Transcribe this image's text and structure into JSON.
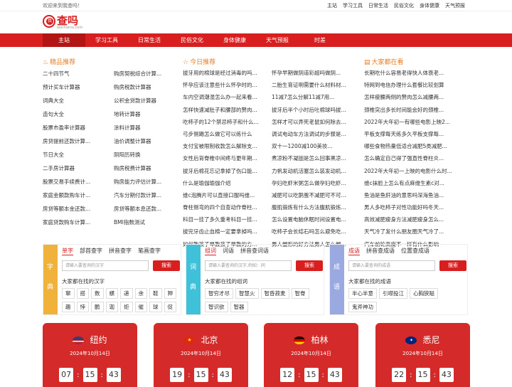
{
  "topbar": {
    "welcome": "欢迎来到我查吗！",
    "links": [
      "主站",
      "学习工具",
      "日常生活",
      "民俗文化",
      "身体健康",
      "天气预报"
    ]
  },
  "logo": {
    "badge": "我",
    "name": "查吗",
    "sub": "wochama.com"
  },
  "nav": [
    "主站",
    "学习工具",
    "日常生活",
    "民俗文化",
    "身体健康",
    "天气预报",
    "时差"
  ],
  "recommend": {
    "title": "精品推荐",
    "items": [
      "二十四节气",
      "购房契税综合计算...",
      "预计买车计算器",
      "购房税款计算器",
      "词典大全",
      "公积金贷款计算器",
      "造句大全",
      "地转计算器",
      "股票市盈率计算器",
      "涂料计算器",
      "房贷提前还款计算...",
      "油价调整计算器",
      "节日大全",
      "阴阳历转换",
      "二手房计算器",
      "购房税费计算器",
      "股票交易手续费计...",
      "购房能力评估计算...",
      "家庭金额款购车计...",
      "汽车分期付款计算...",
      "房贷等额本金还款...",
      "房贷等额本息还款...",
      "家庭贷款购车计算...",
      "BMI指数测试"
    ]
  },
  "today": {
    "title": "今日推荐",
    "items": [
      "拔牙用的棉球是经过消毒的吗...",
      "怀孕早期做阴道彩超吗做阴...",
      "怀孕应该注意些什么怀孕时的...",
      "二胎生育证明需要什么材料材...",
      "车内空调潮湿怎么办一起来看...",
      "11减7怎么分解11减7用...",
      "怎样快速减肚子和腰部的赘肉...",
      "拔牙后半个小时后吐棉球吗拔...",
      "吃柿子的12个禁忌柿子和什么...",
      "怎样才可以弄死老鼠如何除去...",
      "弓步侧踢怎么做它可以练什么",
      "调试电动车方法调试的步骤是...",
      "支付宝被限制收款怎么解除支...",
      "双十一1200减100美妆...",
      "女性后背脊椎中间疼与更年期...",
      "煮凉粉不凝固是怎么回事黑凉...",
      "拔牙后棉花忘记拿掉了伤口能...",
      "力帆发动机活塞怎么装发动机...",
      "什么是瑜伽瑜伽介绍",
      "孕妇吃虾米粥怎么做孕妇吃虾...",
      "维c泡腾片可以直接口服吗维...",
      "减肥可以吃鹅蛋不减肥可不可...",
      "脊柱侧弯的四个自查动作脊柱...",
      "腹肌锻炼有什么方法腹肌锻炼...",
      "科目一挂了多久重考科目一挂...",
      "怎么设置电脑休眠时间设置电...",
      "拔完牙齿止血棉一定要拿掉吗...",
      "吃柿子会长结石吗怎么避免吃...",
      "如何教孩子早教孩子早教的方...",
      "男人塑形的好方法男人怎么塑..."
    ]
  },
  "hot": {
    "title": "大家都在看",
    "items": [
      "长期吃什么容易老得快人体衰老...",
      "特网到电信办理什么套餐比较划算",
      "怎样瘦腰两侧的赘肉怎么减腰两...",
      "颈椎突出多长时间能会好的颈椎...",
      "2022年大年初一有哪些电影上映2...",
      "平板支撑每天练多久平板支撑每...",
      "哪些食物热量低适合减肥5类减肥...",
      "怎么确定自己得了强直性脊柱炎...",
      "2022年大年初一上映的电影什么时...",
      "维c抹脸上怎么有点麻维生素c对...",
      "鱼油是鱼肝油的意思吗深海鱼油...",
      "男人多吃柿子对性功能好吗冬天...",
      "高效减肥瘦身方法减肥瘦身怎么...",
      "天气冷了发什么朋友圈天气冷了...",
      "汽车前轮高度不一样有什么影响"
    ]
  },
  "dicts": [
    {
      "side": [
        "字",
        "典"
      ],
      "tabs": [
        "单字",
        "部首查字",
        "拼音查字",
        "笔画查字"
      ],
      "placeholder": "请输入要查询的汉字",
      "button": "搜索",
      "hint": "大家都在找的汉字",
      "chips": [
        "窜",
        "搭",
        "数",
        "蟥",
        "递",
        "余",
        "鞋",
        "狎",
        "趣",
        "悖",
        "鹏",
        "迦",
        "炬",
        "催",
        "球",
        "促"
      ]
    },
    {
      "side": [
        "词",
        "典"
      ],
      "tabs": [
        "组词",
        "词语",
        "拼音查词语"
      ],
      "placeholder": "请输入要查询的汉字,例如：同",
      "button": "搜索",
      "hint": "大家都在找的组词",
      "chips": [
        "智穷才尽",
        "智慧火",
        "智昏菽麦",
        "智脊",
        "智识欲",
        "智器"
      ]
    },
    {
      "side": [
        "成",
        "语"
      ],
      "tabs": [
        "成语",
        "拼音查成语",
        "位置查成语"
      ],
      "placeholder": "请输入要查询的成语",
      "button": "搜索",
      "hint": "大家都在找的成语",
      "chips": [
        "半心半意",
        "引噤投江",
        "心胸狭隘",
        "鬼斧神功"
      ]
    }
  ],
  "clocks": [
    {
      "city": "纽约",
      "date": "2024年10月14日",
      "h": "07",
      "m": "15",
      "s": "43",
      "flag": "us"
    },
    {
      "city": "北京",
      "date": "2024年10月14日",
      "h": "19",
      "m": "15",
      "s": "43",
      "flag": "cn"
    },
    {
      "city": "柏林",
      "date": "2024年10月14日",
      "h": "12",
      "m": "15",
      "s": "43",
      "flag": "de"
    },
    {
      "city": "悉尼",
      "date": "2024年10月14日",
      "h": "22",
      "m": "15",
      "s": "43",
      "flag": "au"
    }
  ],
  "colors": {
    "brand": "#d81e1e",
    "accent": "#e67e22"
  }
}
